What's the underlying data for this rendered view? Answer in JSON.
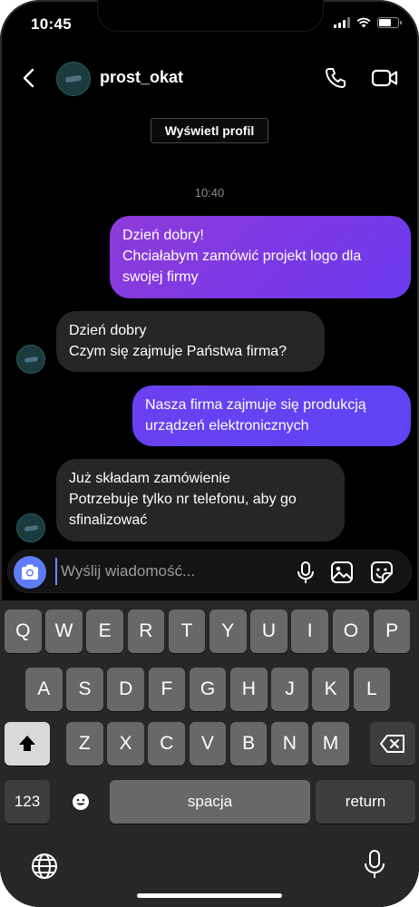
{
  "status_bar": {
    "time": "10:45"
  },
  "header": {
    "username": "prost_okat"
  },
  "view_profile_label": "Wyświetl profil",
  "timestamp": "10:40",
  "messages": [
    {
      "direction": "sent",
      "lines": [
        "Dzień dobry!",
        "Chciałabym zamówić projekt logo dla",
        "swojej firmy"
      ]
    },
    {
      "direction": "received",
      "lines": [
        "Dzień dobry",
        "Czym się zajmuje Państwa firma?"
      ]
    },
    {
      "direction": "sent",
      "lines": [
        "Nasza firma zajmuje się produkcją",
        "urządzeń elektronicznych"
      ]
    },
    {
      "direction": "received",
      "lines": [
        "Już składam zamówienie",
        "Potrzebuje tylko nr telefonu, aby go",
        "sfinalizować"
      ]
    }
  ],
  "composer": {
    "placeholder": "Wyślij wiadomość..."
  },
  "keyboard": {
    "row1": [
      "Q",
      "W",
      "E",
      "R",
      "T",
      "Y",
      "U",
      "I",
      "O",
      "P"
    ],
    "row2": [
      "A",
      "S",
      "D",
      "F",
      "G",
      "H",
      "J",
      "K",
      "L"
    ],
    "row3": [
      "Z",
      "X",
      "C",
      "V",
      "B",
      "N",
      "M"
    ],
    "numbers_label": "123",
    "space_label": "spacja",
    "return_label": "return"
  },
  "colors": {
    "sent_bubble_1": "#8e3bd9",
    "sent_bubble_2": "#5d44f5",
    "received_bubble": "#262626",
    "camera_button": "#5f7bf5"
  },
  "icons": [
    "back-arrow-icon",
    "phone-icon",
    "video-camera-icon",
    "camera-icon",
    "microphone-icon",
    "gallery-icon",
    "sticker-icon",
    "shift-icon",
    "backspace-icon",
    "emoji-icon",
    "globe-icon",
    "dictation-icon"
  ]
}
